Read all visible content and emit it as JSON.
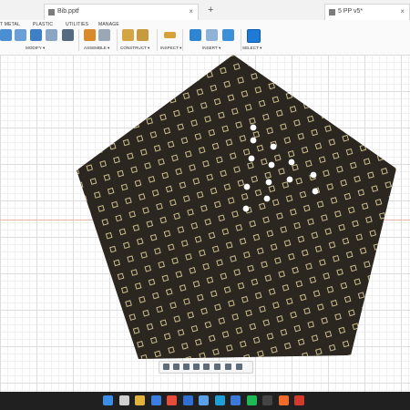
{
  "tabs": [
    {
      "label": "Bib.pptf",
      "close": "×"
    },
    {
      "label": "5 PP v5*",
      "close": "×"
    }
  ],
  "ribbon": {
    "tabs": [
      "T METAL",
      "PLASTIC",
      "UTILITIES",
      "MANAGE"
    ],
    "groups": [
      "MODIFY ▾",
      "ASSEMBLE ▾",
      "CONSTRUCT ▾",
      "INSPECT ▾",
      "INSERT ▾",
      "SELECT ▾"
    ],
    "accent": "#1f7ad6"
  },
  "model": {
    "plate_color": "#2b2620",
    "pad_color": "#c9bc8c",
    "hole_color": "#ffffff",
    "hole_count": 13
  },
  "taskbar": {
    "icons": [
      "start-icon",
      "search-icon",
      "files-icon",
      "browser-icon",
      "chrome-icon",
      "mail-icon",
      "photos-icon",
      "edge-icon",
      "store-icon",
      "spotify-icon",
      "app-icon",
      "fusion-icon",
      "office-icon"
    ]
  }
}
